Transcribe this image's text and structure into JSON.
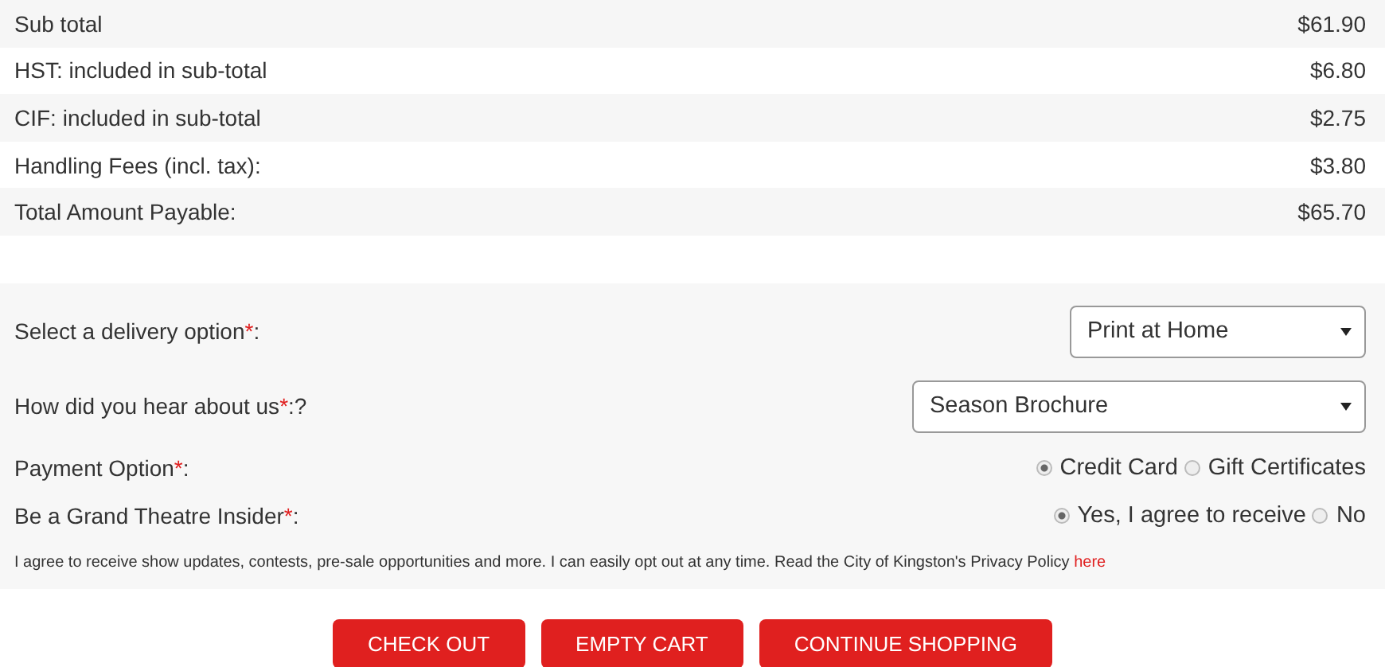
{
  "summary": [
    {
      "label": "Sub total",
      "amount": "$61.90"
    },
    {
      "label": "HST: included in sub-total",
      "amount": "$6.80"
    },
    {
      "label": "CIF: included in sub-total",
      "amount": "$2.75"
    },
    {
      "label": "Handling Fees (incl. tax):",
      "amount": "$3.80"
    },
    {
      "label": "Total Amount Payable:",
      "amount": "$65.70"
    }
  ],
  "form": {
    "fields": [
      {
        "kind": "select",
        "label": "Select a delivery option",
        "mark": "*",
        "suffix": ":",
        "value": "Print at Home"
      },
      {
        "kind": "select",
        "label": "How did you hear about us",
        "mark": "*",
        "suffix": ":?",
        "value": "Season Brochure"
      },
      {
        "kind": "radio",
        "label": "Payment Option",
        "mark": "*",
        "suffix": ":",
        "options": [
          {
            "label": "Credit Card",
            "selected": true
          },
          {
            "label": "Gift Certificates",
            "selected": false
          }
        ]
      },
      {
        "kind": "radio",
        "label": "Be a Grand Theatre Insider",
        "mark": "*",
        "suffix": ":",
        "options": [
          {
            "label": "Yes, I agree to receive",
            "selected": true
          },
          {
            "label": "No",
            "selected": false
          }
        ]
      }
    ],
    "consent": {
      "text": "I agree to receive show updates, contests, pre-sale opportunities and more. I can easily opt out at any time. Read the City of Kingston's Privacy Policy",
      "link": "here"
    }
  },
  "buttons": [
    "CHECK OUT",
    "EMPTY CART",
    "CONTINUE SHOPPING"
  ]
}
